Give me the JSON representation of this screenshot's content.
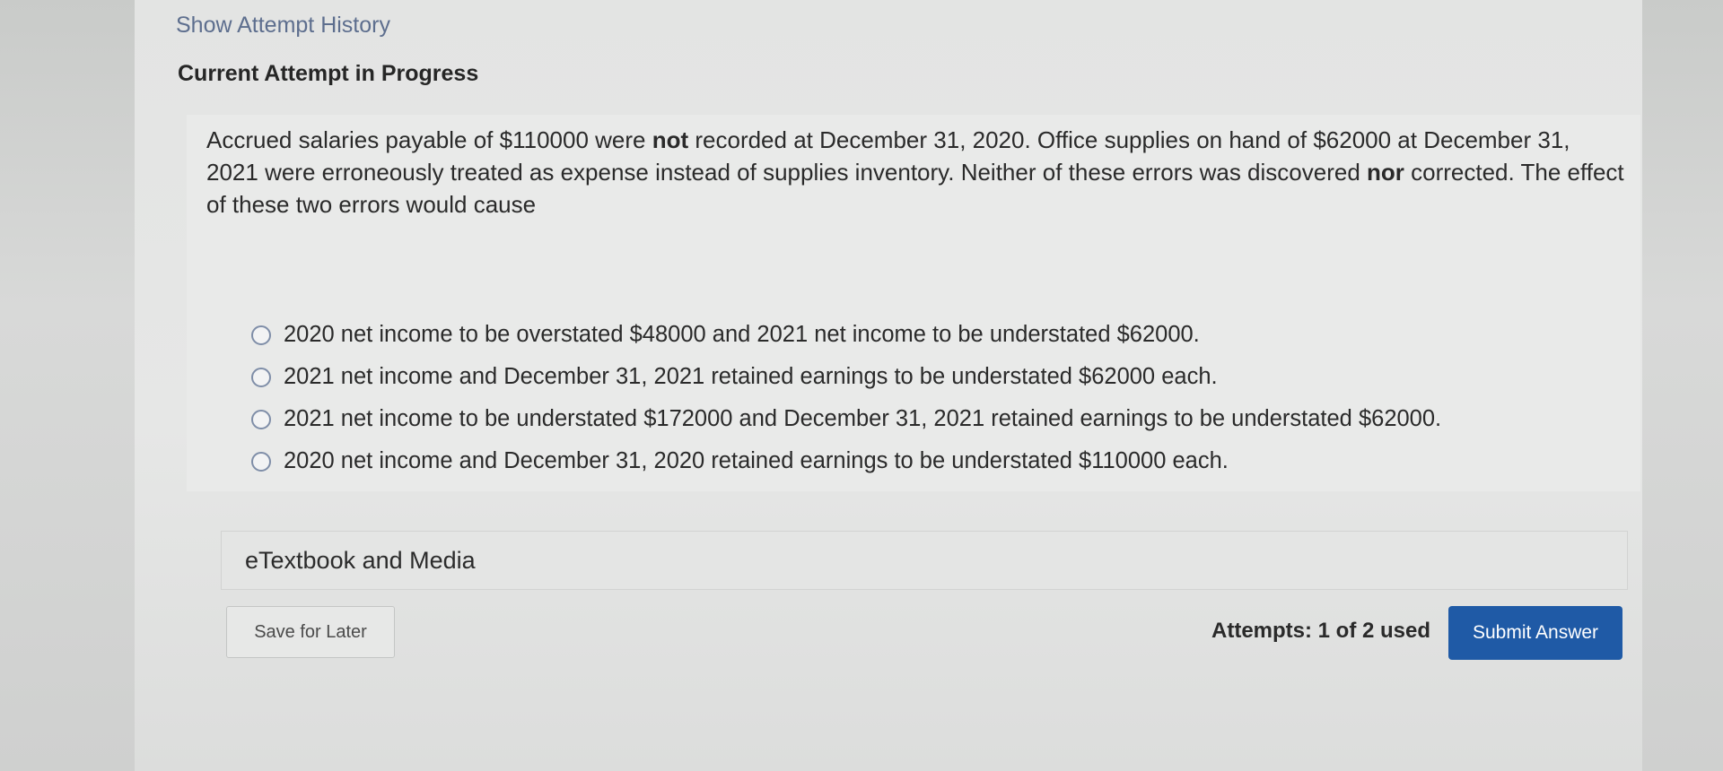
{
  "header": {
    "history_link": "Show Attempt History",
    "attempt_title": "Current Attempt in Progress"
  },
  "question": {
    "part1": "Accrued salaries payable of $110000 were ",
    "emph1": "not",
    "part2": " recorded at December 31, 2020. Office supplies on hand of $62000 at December 31, 2021 were erroneously treated as expense instead of supplies inventory. Neither of these errors was discovered ",
    "emph2": "nor",
    "part3": " corrected. The effect of these two errors would cause"
  },
  "options": [
    {
      "label": "2020 net income to be overstated $48000 and 2021 net income to be understated $62000."
    },
    {
      "label": "2021 net income and December 31, 2021 retained earnings to be understated $62000 each."
    },
    {
      "label": "2021 net income to be understated $172000 and December 31, 2021 retained earnings to be understated $62000."
    },
    {
      "label": "2020 net income and December 31, 2020 retained earnings to be understated $110000 each."
    }
  ],
  "resources": {
    "label": "eTextbook and Media"
  },
  "footer": {
    "save_label": "Save for Later",
    "attempts_text": "Attempts: 1 of 2 used",
    "submit_label": "Submit Answer"
  },
  "colors": {
    "link": "#5d6e8e",
    "submit_button": "#1f5aa6",
    "radio_border": "#7f8ea8"
  }
}
